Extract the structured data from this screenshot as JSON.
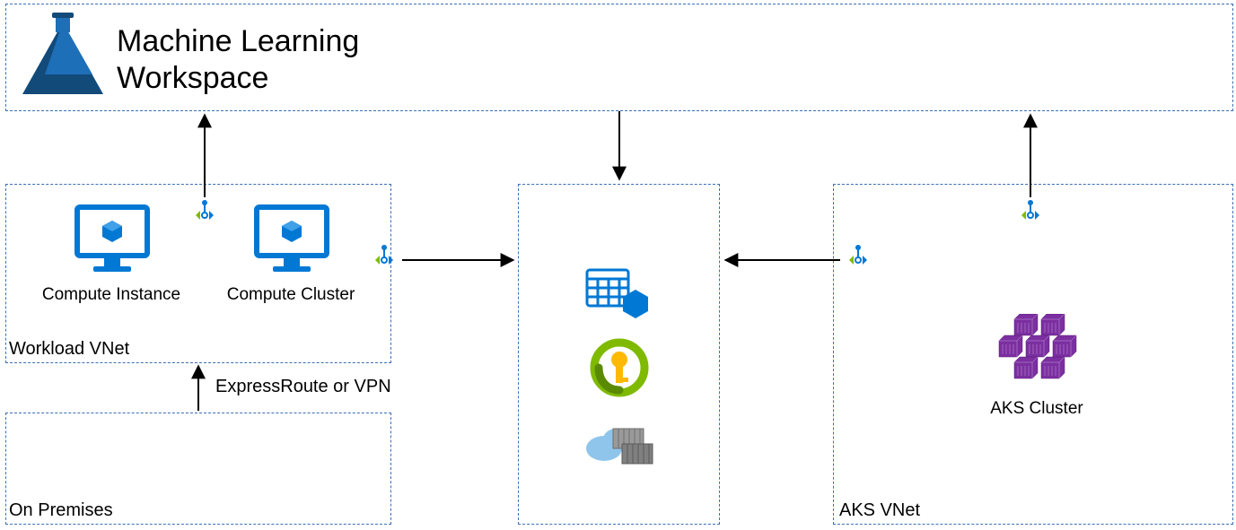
{
  "workspace": {
    "title_line1": "Machine Learning",
    "title_line2": "Workspace"
  },
  "workload_vnet": {
    "label": "Workload VNet",
    "compute_instance_label": "Compute Instance",
    "compute_cluster_label": "Compute Cluster"
  },
  "on_premises": {
    "label": "On Premises",
    "connection_label": "ExpressRoute or VPN"
  },
  "aks_vnet": {
    "label": "AKS VNet",
    "cluster_label": "AKS Cluster"
  },
  "colors": {
    "azure_blue": "#0078d4",
    "dash_blue": "#3b6fb6",
    "ml_dark": "#0f4c81",
    "purple": "#7b2fa0",
    "green": "#7fba00",
    "yellow": "#ffb900"
  }
}
